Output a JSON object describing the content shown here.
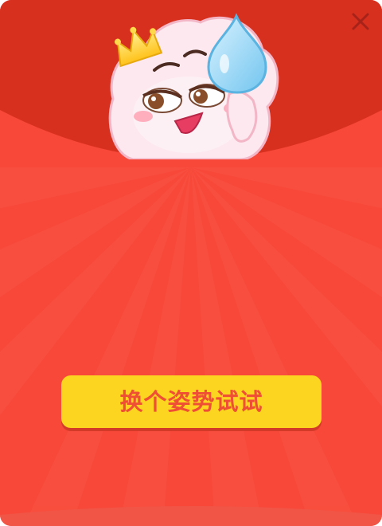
{
  "dialog": {
    "action_label": "换个姿势试试",
    "close_icon": "close-icon",
    "mascot": "cloud-mascot-with-crown-and-sweat-drop"
  },
  "colors": {
    "background": "#f7483a",
    "top_flap": "#d8301f",
    "button": "#fbd51f",
    "button_text": "#ef4f34",
    "close_icon": "#a7231a"
  }
}
